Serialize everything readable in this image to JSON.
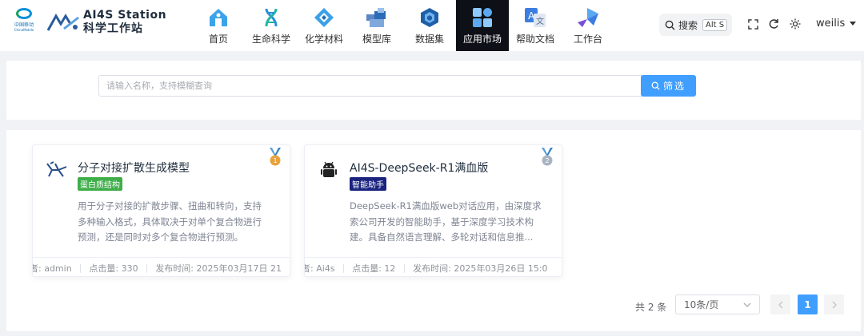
{
  "brand": {
    "cm_name": "中国移动",
    "cm_en": "ChinaMobile",
    "title_line1": "AI4S Station",
    "title_line2": "科学工作站"
  },
  "nav": [
    {
      "label": "首页",
      "icon": "home-icon"
    },
    {
      "label": "生命科学",
      "icon": "dna-icon"
    },
    {
      "label": "化学材料",
      "icon": "chemistry-icon"
    },
    {
      "label": "模型库",
      "icon": "cube-stack-icon"
    },
    {
      "label": "数据集",
      "icon": "dataset-icon"
    },
    {
      "label": "应用市场",
      "icon": "app-grid-icon",
      "active": true
    },
    {
      "label": "帮助文档",
      "icon": "translate-icon"
    },
    {
      "label": "工作台",
      "icon": "workbench-icon"
    }
  ],
  "header": {
    "search_label": "搜索",
    "search_shortcut": "Alt S",
    "username": "weilis"
  },
  "filter": {
    "placeholder": "请输入名称，支持模糊查询",
    "value": "",
    "button_label": "筛选"
  },
  "apps": [
    {
      "title": "分子对接扩散生成模型",
      "tag": "蛋白质结构",
      "tag_color": "#3fae49",
      "rank": "1",
      "medal_color": "#e8a23b",
      "description": "用于分子对接的扩散步骤、扭曲和转向，支持多种输入格式，具体取决于对单个复合物进行预测，还是同时对多个复合物进行预测。",
      "author": "者: admin",
      "clicks": "点击量: 330",
      "published": "发布时间: 2025年03月17日 21"
    },
    {
      "title": "AI4S-DeepSeek-R1满血版",
      "tag": "智能助手",
      "tag_color": "#1a237e",
      "rank": "2",
      "medal_color": "#a9b4c2",
      "description": "DeepSeek-R1满血版web对话应用，由深度求索公司开发的智能助手，基于深度学习技术构建。具备自然语言理解、多轮对话和信息推...",
      "author": "者: Ai4s",
      "clicks": "点击量: 12",
      "published": "发布时间: 2025年03月26日 15:0"
    }
  ],
  "pagination": {
    "total": "共 2 条",
    "page_size": "10条/页",
    "current_page": "1"
  },
  "colors": {
    "accent": "#409eff",
    "nav_active_bg": "#0d1117"
  }
}
